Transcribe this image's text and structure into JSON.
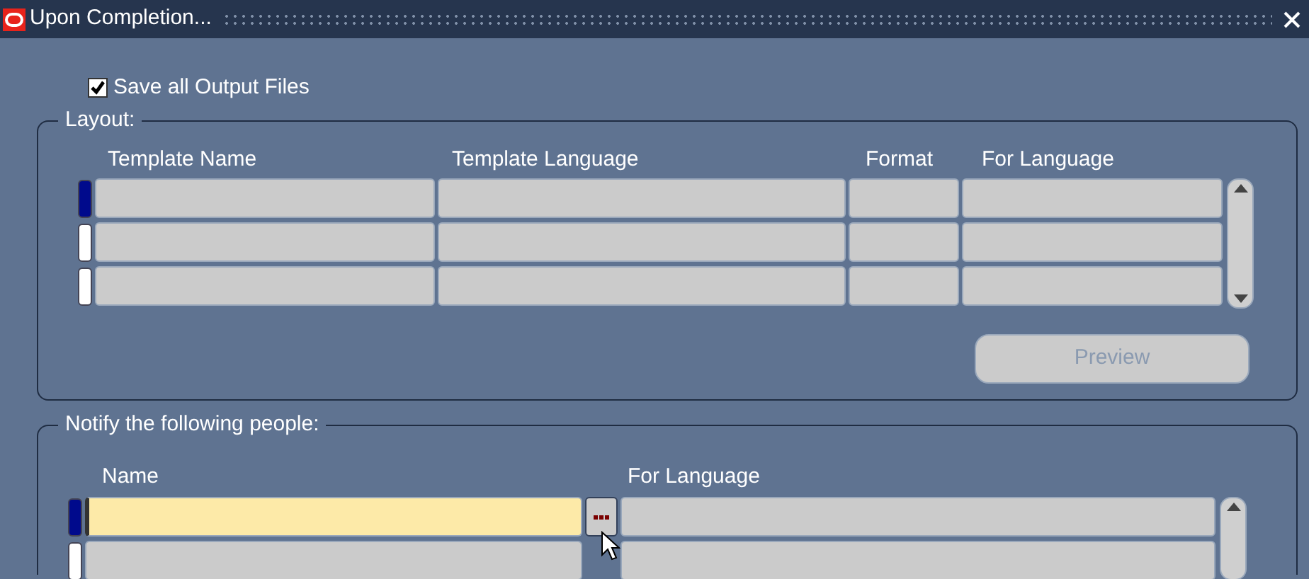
{
  "window": {
    "title": "Upon Completion..."
  },
  "save_all_output_files": {
    "label": "Save all Output Files",
    "checked": true
  },
  "layout": {
    "legend": "Layout:",
    "columns": [
      "Template Name",
      "Template Language",
      "Format",
      "For Language"
    ],
    "rows": [
      {
        "selected": true
      },
      {
        "selected": false
      },
      {
        "selected": false
      }
    ],
    "preview_button": {
      "label": "Preview",
      "disabled": true
    }
  },
  "notify": {
    "legend": "Notify the following people:",
    "columns": [
      "Name",
      "For Language"
    ],
    "rows": [
      {
        "selected": true
      },
      {
        "selected": false
      }
    ]
  }
}
